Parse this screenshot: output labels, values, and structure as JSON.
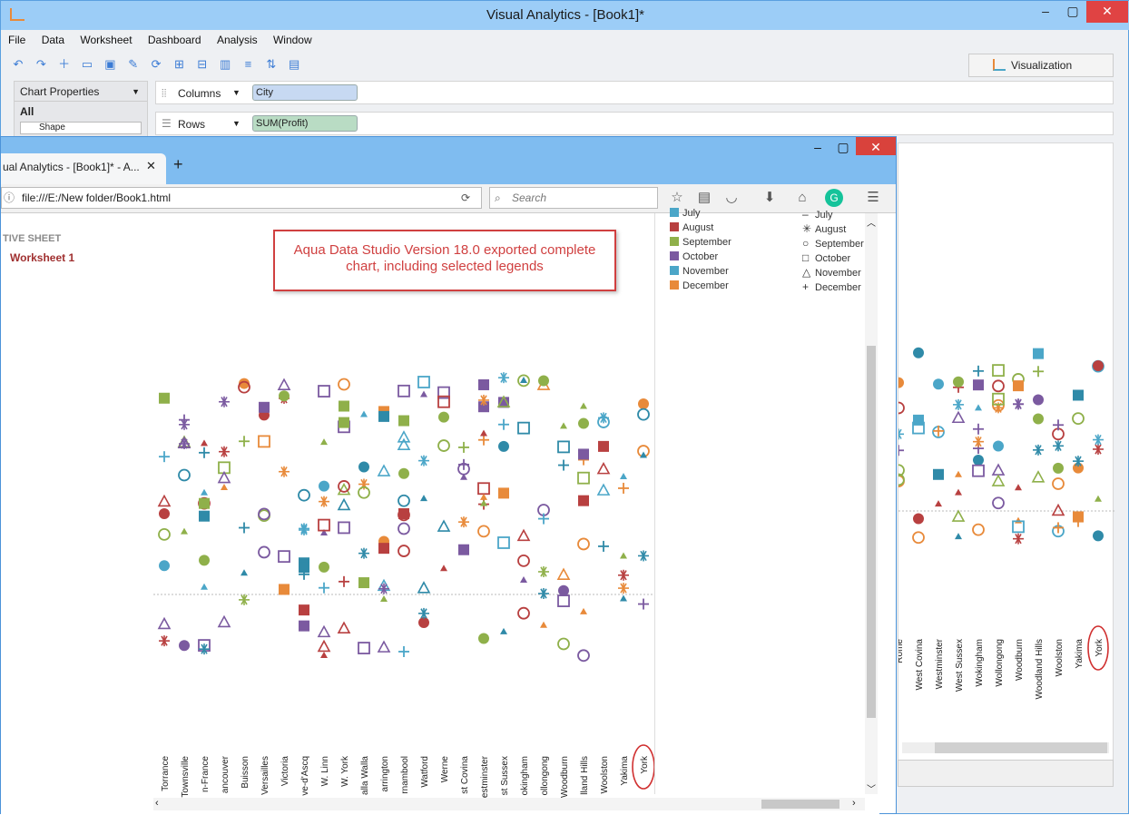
{
  "app": {
    "title": "Visual Analytics - [Book1]*",
    "menu": [
      "File",
      "Data",
      "Worksheet",
      "Dashboard",
      "Analysis",
      "Window"
    ],
    "visualization_tab": "Visualization",
    "chart_properties": "Chart Properties",
    "marks_all": "All",
    "marks_shape": "Shape",
    "columns_label": "Columns",
    "columns_pill": "City",
    "rows_label": "Rows",
    "rows_pill": "SUM(Profit)"
  },
  "browser": {
    "tab_title": "ual Analytics - [Book1]* - A...",
    "url": "file:///E:/New folder/Book1.html",
    "search_placeholder": "Search",
    "sheet_label": "TIVE SHEET",
    "worksheet_label": "Worksheet 1",
    "callout": "Aqua Data Studio Version 18.0 exported complete chart, including selected legends"
  },
  "legend_color": [
    {
      "label": "July",
      "color": "#4ba6c8"
    },
    {
      "label": "August",
      "color": "#b84040"
    },
    {
      "label": "September",
      "color": "#8fb04a"
    },
    {
      "label": "October",
      "color": "#7b5aa0"
    },
    {
      "label": "November",
      "color": "#4ba6c8"
    },
    {
      "label": "December",
      "color": "#e88a3a"
    }
  ],
  "legend_shape": [
    {
      "label": "July",
      "shape": "dash"
    },
    {
      "label": "August",
      "shape": "asterisk"
    },
    {
      "label": "September",
      "shape": "circle"
    },
    {
      "label": "October",
      "shape": "square"
    },
    {
      "label": "November",
      "shape": "triangle"
    },
    {
      "label": "December",
      "shape": "plus"
    }
  ],
  "cities_main": [
    "Torrance",
    "Townsville",
    "n-France",
    "ancouver",
    "Buisson",
    "Versailles",
    "Victoria",
    "ve-d'Ascq",
    "W. Linn",
    "W. York",
    "alla Walla",
    "arrington",
    "rnambool",
    "Watford",
    "Werne",
    "st Covina",
    "estminster",
    "st Sussex",
    "okingham",
    "ollongong",
    "Woodburn",
    "lland Hills",
    "Woolston",
    "Yakima",
    "York"
  ],
  "cities_back": [
    "Rome",
    "West Covina",
    "Westminster",
    "West Sussex",
    "Wokingham",
    "Wollongong",
    "Woodburn",
    "Woodland Hills",
    "Woolston",
    "Yakima",
    "York"
  ]
}
